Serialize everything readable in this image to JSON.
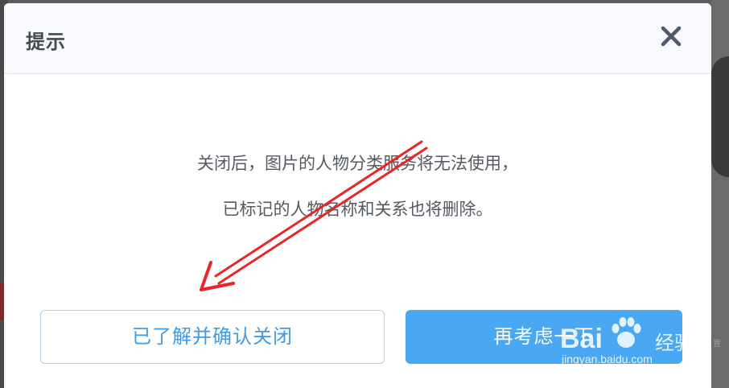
{
  "dialog": {
    "title": "提示",
    "close_icon": "close-icon",
    "message_lines": [
      "关闭后，图片的人物分类服务将无法使用，",
      "已标记的人物名称和关系也将删除。"
    ],
    "confirm_button": "已了解并确认关闭",
    "cancel_button": "再考虑一下"
  },
  "background": {
    "right_edge_text": "置"
  },
  "watermark": {
    "brand": "Bai",
    "brand_suffix": "经验",
    "url": "jingyan.baidu.com",
    "icon": "paw-icon"
  },
  "colors": {
    "primary": "#4aa7f2",
    "primary_text": "#3f9be6",
    "annotation": "#e8262a",
    "title": "#444a52",
    "message": "#555a61"
  }
}
